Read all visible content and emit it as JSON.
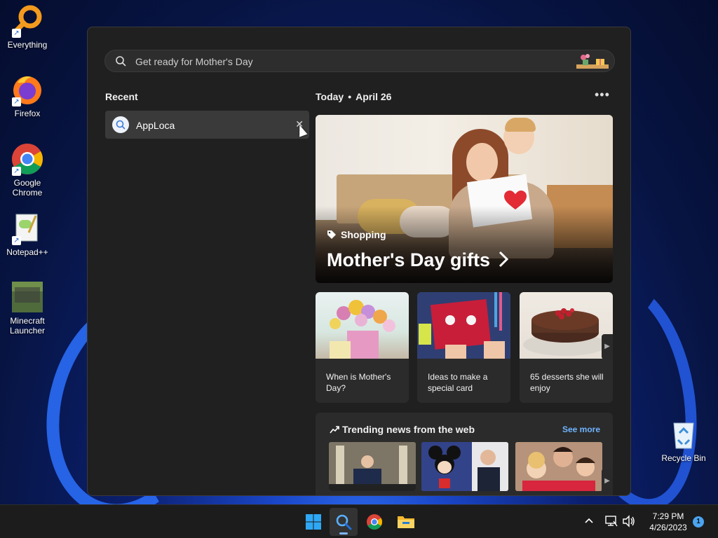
{
  "desktop": {
    "icons": [
      {
        "label": "Everything"
      },
      {
        "label": "Firefox"
      },
      {
        "label": "Google Chrome"
      },
      {
        "label": "Notepad++"
      },
      {
        "label": "Minecraft Launcher"
      },
      {
        "label": "Recycle Bin"
      }
    ]
  },
  "search": {
    "placeholder": "Get ready for Mother's Day"
  },
  "recent": {
    "title": "Recent",
    "items": [
      {
        "label": "AppLoca"
      }
    ]
  },
  "today": {
    "label": "Today",
    "date": "April 26"
  },
  "hero": {
    "tag": "Shopping",
    "title": "Mother's Day gifts"
  },
  "cards": [
    {
      "text": "When is Mother's Day?"
    },
    {
      "text": "Ideas to make a special card"
    },
    {
      "text": "65 desserts she will enjoy"
    }
  ],
  "trending": {
    "title": "Trending news from the web",
    "see_more": "See more"
  },
  "taskbar": {
    "time": "7:29 PM",
    "date": "4/26/2023",
    "notification_count": "1"
  },
  "colors": {
    "accent": "#6fb4ff",
    "panel_bg": "#202020",
    "taskbar_bg": "#1c1c1c"
  },
  "icons": [
    "search-icon",
    "close-icon",
    "more-icon",
    "tag-icon",
    "chevron-right-icon",
    "trending-icon",
    "windows-start-icon",
    "chrome-icon",
    "file-explorer-icon",
    "network-icon",
    "volume-icon"
  ]
}
